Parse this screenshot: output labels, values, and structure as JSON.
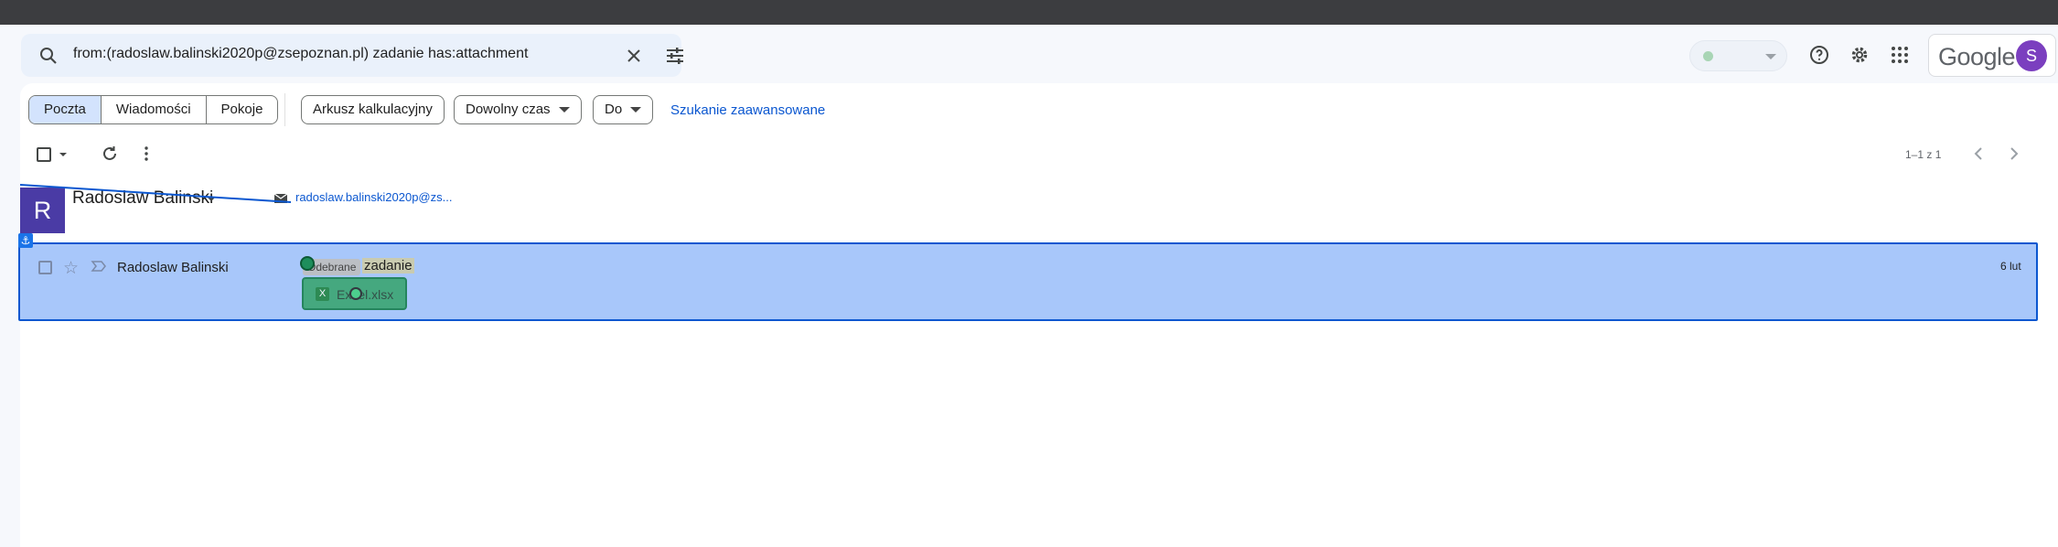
{
  "search": {
    "query": "from:(radoslaw.balinski2020p@zsepoznan.pl) zadanie has:attachment"
  },
  "header": {
    "brand": "Google",
    "account_initial": "S"
  },
  "filters": {
    "segments": [
      "Poczta",
      "Wiadomości",
      "Pokoje"
    ],
    "chips": [
      "Arkusz kalkulacyjny",
      "Dowolny czas",
      "Do"
    ],
    "advanced_link": "Szukanie zaawansowane"
  },
  "pagination": {
    "label": "1–1 z 1"
  },
  "contact": {
    "initial": "R",
    "name": "Radoslaw Balinski",
    "email": "radoslaw.balinski2020p@zs..."
  },
  "row": {
    "sender": "Radoslaw Balinski",
    "label": "Odebrane",
    "subject": "zadanie",
    "date": "6 lut",
    "attachment": {
      "type_glyph": "X",
      "filename": "Excel.xlsx"
    }
  },
  "colors": {
    "selection": "#a8c7fa",
    "selection_border": "#0b57d0",
    "link": "#0b57d0",
    "contact_avatar": "#4a3ba5"
  }
}
